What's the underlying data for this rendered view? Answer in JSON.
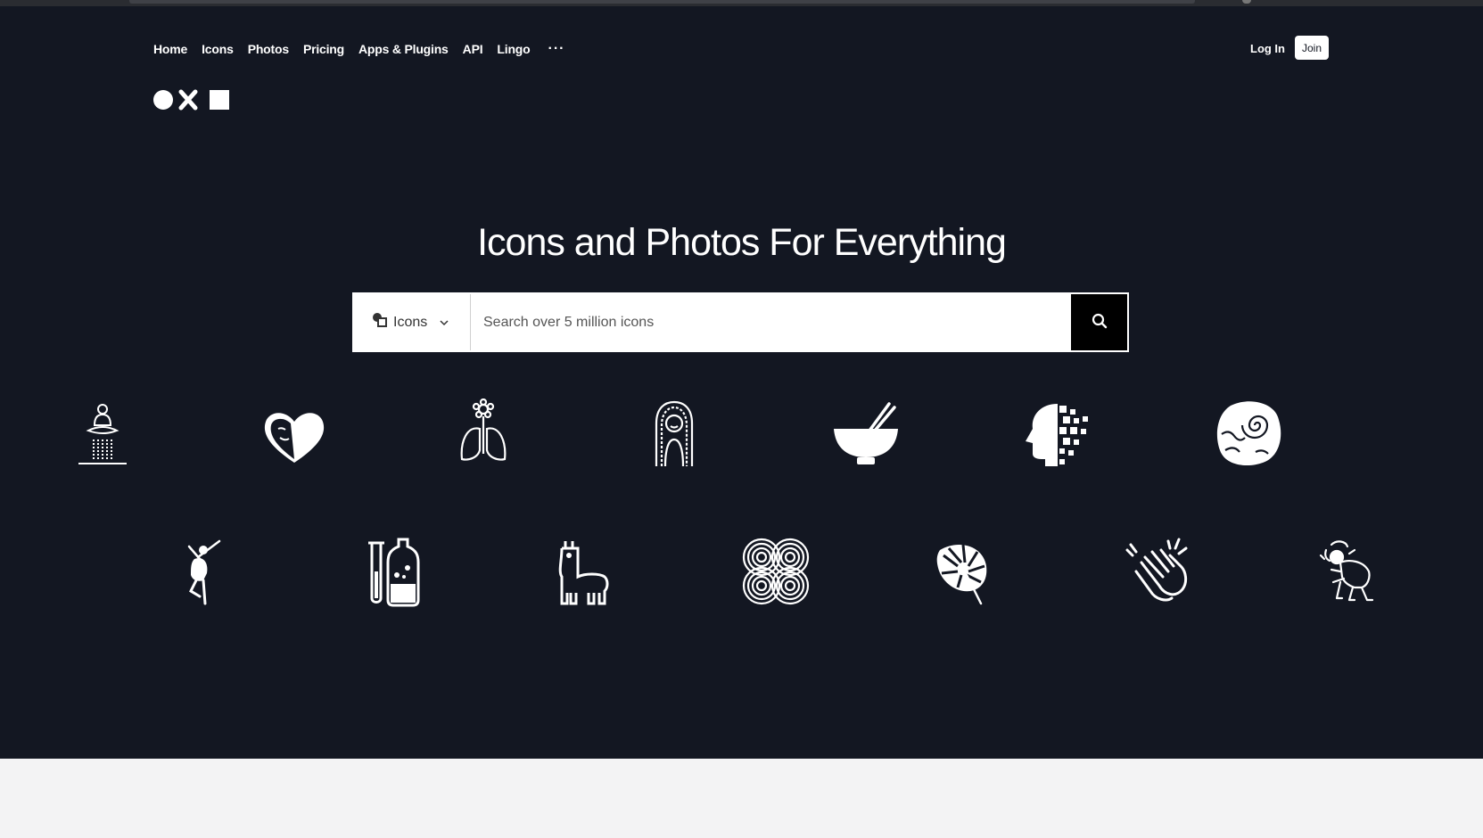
{
  "nav": {
    "items": [
      "Home",
      "Icons",
      "Photos",
      "Pricing",
      "Apps & Plugins",
      "API",
      "Lingo"
    ],
    "more": "···"
  },
  "auth": {
    "login": "Log In",
    "join": "Join"
  },
  "hero": {
    "title": "Icons and Photos For Everything"
  },
  "search": {
    "type_label": "Icons",
    "placeholder": "Search over 5 million icons"
  },
  "icons": {
    "row1": [
      "meditation-icon",
      "heart-face-icon",
      "lungs-flower-icon",
      "woman-portrait-icon",
      "bowl-chopsticks-icon",
      "pixel-head-icon",
      "fossil-rock-icon"
    ],
    "row2": [
      "dancer-icon",
      "test-tubes-icon",
      "llama-icon",
      "spiral-pattern-icon",
      "monstera-leaf-icon",
      "clapping-hands-icon",
      "crouching-person-icon"
    ]
  },
  "colors": {
    "hero_bg": "#131722",
    "page_bg": "#f3f3f4",
    "search_button": "#000000",
    "text": "#ffffff"
  }
}
